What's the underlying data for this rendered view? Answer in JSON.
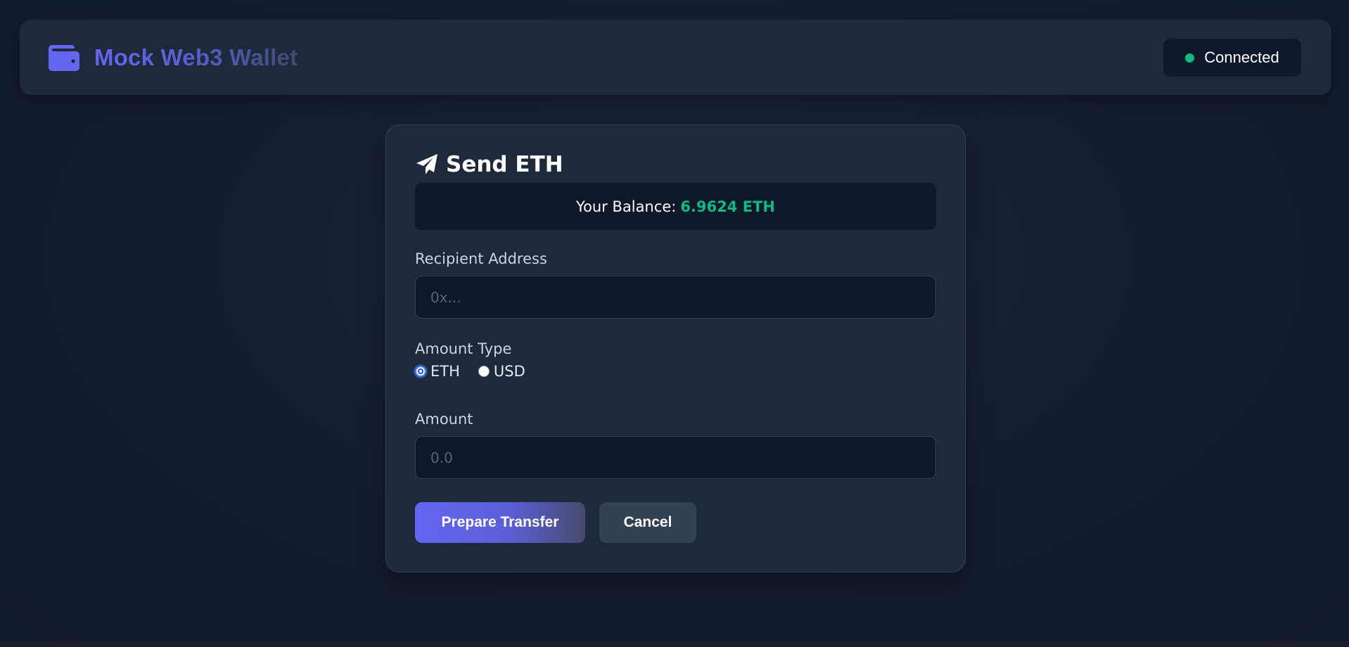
{
  "header": {
    "icon": "wallet-icon",
    "title": "Mock Web3 Wallet",
    "status": {
      "label": "Connected",
      "color": "#10b981"
    }
  },
  "send_card": {
    "icon": "paper-plane-icon",
    "title": "Send ETH",
    "balance": {
      "label": "Your Balance:",
      "value": "6.9624 ETH"
    },
    "recipient": {
      "label": "Recipient Address",
      "placeholder": "0x...",
      "value": ""
    },
    "amount_type": {
      "label": "Amount Type",
      "options": [
        {
          "label": "ETH",
          "selected": true
        },
        {
          "label": "USD",
          "selected": false
        }
      ]
    },
    "amount": {
      "label": "Amount",
      "placeholder": "0.0",
      "value": ""
    },
    "buttons": {
      "prepare": "Prepare Transfer",
      "cancel": "Cancel"
    }
  },
  "colors": {
    "accent": "#6366f1",
    "success": "#10b981",
    "card_bg": "#1e293b",
    "input_bg": "#0f172a"
  }
}
